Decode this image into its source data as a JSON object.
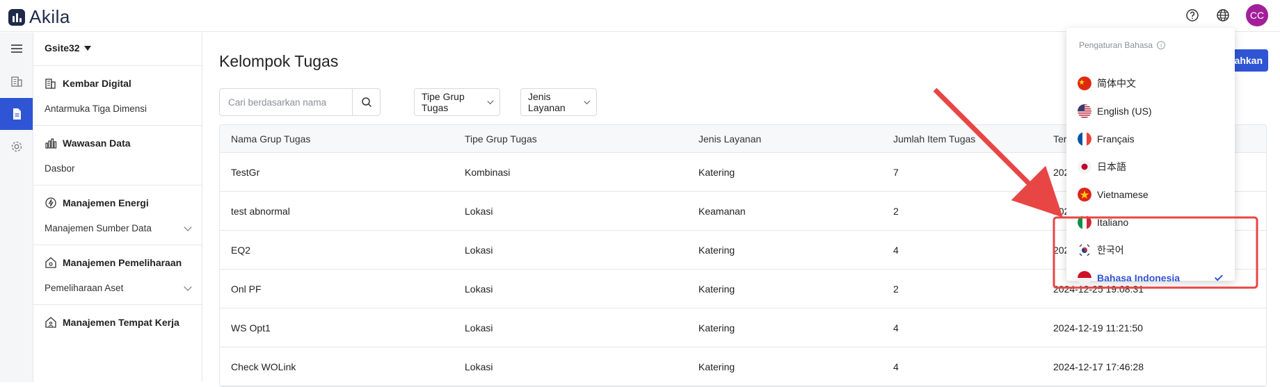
{
  "app": {
    "name": "Akila"
  },
  "header": {
    "help_icon": "question-circle-icon",
    "language_icon": "globe-icon",
    "avatar_initials": "CC",
    "avatar_color": "#a31f9a"
  },
  "rail": {
    "items": [
      "menu-icon",
      "building-icon",
      "document-icon",
      "gear-icon"
    ],
    "active_index": 2,
    "accent": "#2f55d4"
  },
  "nav": {
    "site": "Gsite32",
    "sections": [
      {
        "title": "Kembar Digital",
        "icon": "building-icon",
        "sub": "Antarmuka Tiga Dimensi",
        "expandable": false
      },
      {
        "title": "Wawasan Data",
        "icon": "bar-chart-icon",
        "sub": "Dasbor",
        "expandable": false
      },
      {
        "title": "Manajemen Energi",
        "icon": "lightning-icon",
        "sub": "Manajemen Sumber Data",
        "expandable": true
      },
      {
        "title": "Manajemen Pemeliharaan",
        "icon": "house-gear-icon",
        "sub": "Pemeliharaan Aset",
        "expandable": true
      },
      {
        "title": "Manajemen Tempat Kerja",
        "icon": "house-person-icon",
        "sub": "",
        "expandable": false
      }
    ]
  },
  "main": {
    "title": "Kelompok Tugas",
    "add_button": "ahkan",
    "search_placeholder": "Cari berdasarkan nama",
    "filters": [
      "Tipe Grup Tugas",
      "Jenis Layanan"
    ],
    "table": {
      "headers": [
        "Nama Grup Tugas",
        "Tipe Grup Tugas",
        "Jenis Layanan",
        "Jumlah Item Tugas",
        "Ter"
      ],
      "rows": [
        [
          "TestGr",
          "Kombinasi",
          "Katering",
          "7",
          "202"
        ],
        [
          "test abnormal",
          "Lokasi",
          "Keamanan",
          "2",
          "202"
        ],
        [
          "EQ2",
          "Lokasi",
          "Katering",
          "4",
          "202"
        ],
        [
          "Onl PF",
          "Lokasi",
          "Katering",
          "2",
          "2024-12-25 19:08:31"
        ],
        [
          "WS Opt1",
          "Lokasi",
          "Katering",
          "4",
          "2024-12-19 11:21:50"
        ],
        [
          "Check WOLink",
          "Lokasi",
          "Katering",
          "4",
          "2024-12-17 17:46:28"
        ]
      ]
    }
  },
  "language_menu": {
    "title": "Pengaturan Bahasa",
    "items": [
      {
        "label": "简体中文",
        "flag": "cn"
      },
      {
        "label": "English (US)",
        "flag": "us"
      },
      {
        "label": "Français",
        "flag": "fr"
      },
      {
        "label": "日本語",
        "flag": "jp"
      },
      {
        "label": "Vietnamese",
        "flag": "vn"
      },
      {
        "label": "Italiano",
        "flag": "it"
      },
      {
        "label": "한국어",
        "flag": "kr"
      },
      {
        "label": "Bahasa Indonesia",
        "flag": "id",
        "selected": true
      }
    ]
  },
  "annotation": {
    "color": "#e84545"
  }
}
